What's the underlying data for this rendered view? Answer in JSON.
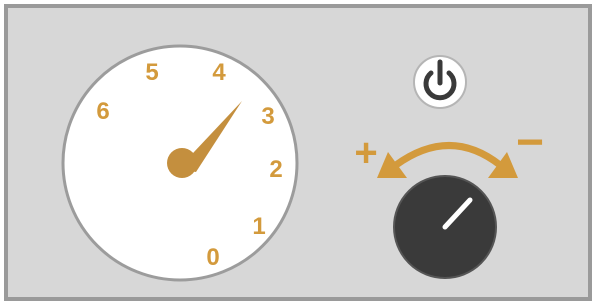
{
  "gauge": {
    "scale_labels": [
      "0",
      "1",
      "2",
      "3",
      "4",
      "5",
      "6"
    ],
    "needle_value": 3.4
  },
  "power_button": {
    "icon": "power-icon"
  },
  "control_knob": {
    "increase_label": "+",
    "decrease_label": "−",
    "icon": "rotate-arrow-icon"
  },
  "colors": {
    "panel_background": "#d7d7d7",
    "panel_border": "#9a9a9a",
    "accent": "#d39a3c",
    "needle": "#c48f3e",
    "knob": "#3a3a3a",
    "dial_face": "#ffffff",
    "dial_border": "#9c9c9c"
  }
}
